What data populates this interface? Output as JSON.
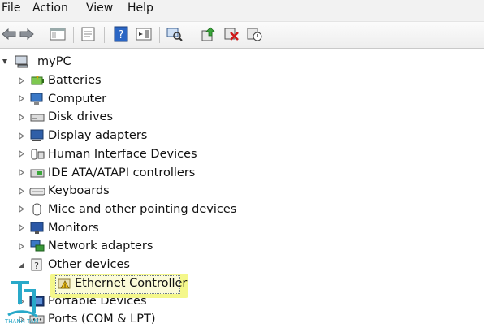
{
  "menubar": {
    "items": [
      "File",
      "Action",
      "View",
      "Help"
    ]
  },
  "toolbar": {
    "buttons": [
      "back-icon",
      "forward-icon",
      "show-hide-console-tree-icon",
      "properties-icon",
      "help-icon",
      "action-pane-icon",
      "scan-hardware-icon",
      "update-driver-icon",
      "uninstall-icon",
      "disable-device-icon"
    ]
  },
  "tree": {
    "root": "myPC",
    "items": [
      {
        "label": "Batteries",
        "icon": "battery-icon",
        "expanded": false
      },
      {
        "label": "Computer",
        "icon": "computer-icon",
        "expanded": false
      },
      {
        "label": "Disk drives",
        "icon": "disk-drive-icon",
        "expanded": false
      },
      {
        "label": "Display adapters",
        "icon": "display-adapter-icon",
        "expanded": false
      },
      {
        "label": "Human Interface Devices",
        "icon": "hid-icon",
        "expanded": false
      },
      {
        "label": "IDE ATA/ATAPI controllers",
        "icon": "ide-controller-icon",
        "expanded": false
      },
      {
        "label": "Keyboards",
        "icon": "keyboard-icon",
        "expanded": false
      },
      {
        "label": "Mice and other pointing devices",
        "icon": "mouse-icon",
        "expanded": false
      },
      {
        "label": "Monitors",
        "icon": "monitor-icon",
        "expanded": false
      },
      {
        "label": "Network adapters",
        "icon": "network-adapter-icon",
        "expanded": false
      },
      {
        "label": "Other devices",
        "icon": "unknown-device-icon",
        "expanded": true
      }
    ],
    "child": {
      "label": "Ethernet Controller",
      "icon": "warning-device-icon"
    },
    "after": [
      {
        "label": "Portable Devices",
        "icon": "portable-device-icon",
        "expanded": false
      },
      {
        "label": "Ports (COM & LPT)",
        "icon": "port-icon",
        "expanded": false
      }
    ]
  },
  "watermark": {
    "text": "THANH TAM"
  },
  "colors": {
    "highlight": "#f4f78a",
    "toolbar_bg": "#eeeeee",
    "icon_blue": "#1f5fb8"
  }
}
